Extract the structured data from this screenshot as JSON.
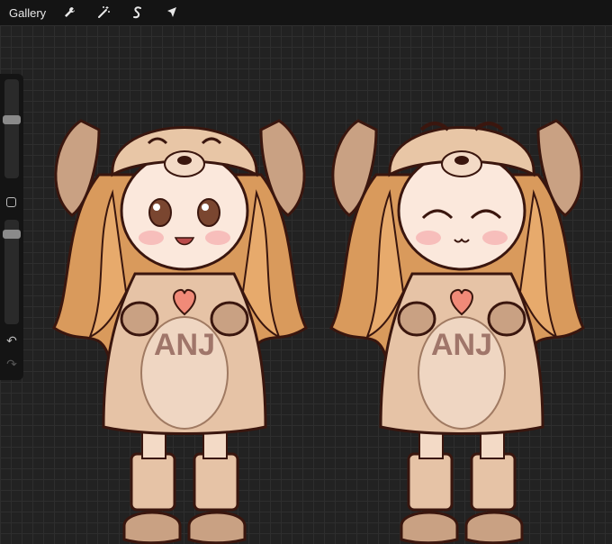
{
  "toolbar": {
    "gallery_label": "Gallery",
    "tools": [
      "wrench-icon",
      "magic-wand-icon",
      "selection-icon",
      "transform-arrow-icon"
    ]
  },
  "sidebar": {
    "brush_size_level": 0.6,
    "opacity_level": 0.9,
    "tools": [
      "modify-square-icon",
      "undo-icon",
      "redo-icon"
    ]
  },
  "artwork": {
    "shirt_text_left": "ANJ",
    "shirt_text_right": "ANJ"
  },
  "colors": {
    "canvas_bg": "#222222",
    "toolbar_bg": "#141414",
    "hat": "#e8c6a6",
    "hair": "#d99a5c",
    "outfit": "#e6c3a6",
    "accent_heart": "#f08a78"
  }
}
